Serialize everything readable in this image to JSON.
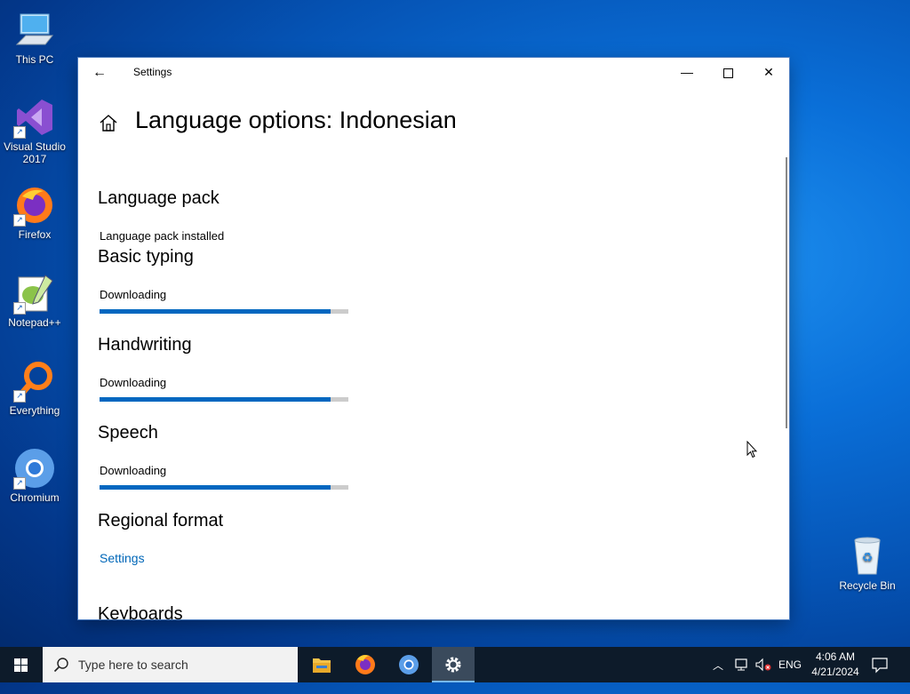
{
  "desktop": {
    "icons": [
      {
        "label": "This PC"
      },
      {
        "label": "Visual Studio 2017"
      },
      {
        "label": "Firefox"
      },
      {
        "label": "Notepad++"
      },
      {
        "label": "Everything"
      },
      {
        "label": "Chromium"
      }
    ],
    "recycle_bin": "Recycle Bin"
  },
  "window": {
    "title": "Settings",
    "page_title": "Language options: Indonesian",
    "sections": {
      "language_pack": {
        "heading": "Language pack",
        "status": "Language pack installed"
      },
      "basic_typing": {
        "heading": "Basic typing",
        "status": "Downloading",
        "progress": 0.93
      },
      "handwriting": {
        "heading": "Handwriting",
        "status": "Downloading",
        "progress": 0.93
      },
      "speech": {
        "heading": "Speech",
        "status": "Downloading",
        "progress": 0.93
      },
      "regional_format": {
        "heading": "Regional format",
        "link": "Settings"
      },
      "keyboards": {
        "heading": "Keyboards"
      }
    }
  },
  "taskbar": {
    "search_placeholder": "Type here to search",
    "tray": {
      "language": "ENG",
      "time": "4:06 AM",
      "date": "4/21/2024"
    }
  },
  "colors": {
    "accent": "#0067c0",
    "link": "#0067b8"
  }
}
